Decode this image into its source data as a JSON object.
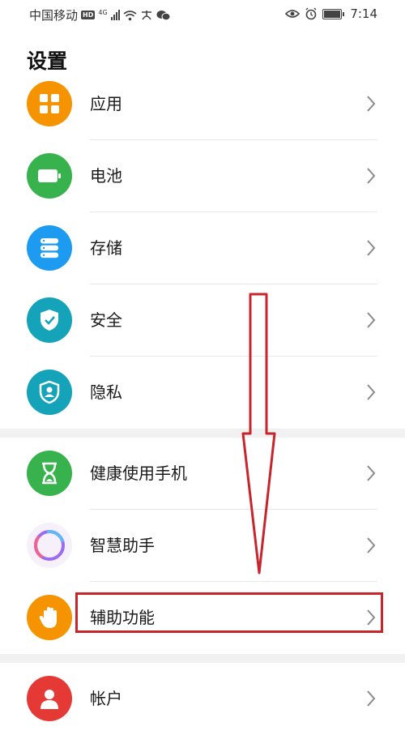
{
  "status_bar": {
    "carrier": "中国移动",
    "hd_badge": "HD",
    "network": "4G",
    "time": "7:14"
  },
  "page": {
    "title": "设置"
  },
  "settings": {
    "items": [
      {
        "label": "应用",
        "icon": "apps-icon",
        "color": "#f59300"
      },
      {
        "label": "电池",
        "icon": "battery-icon",
        "color": "#37b24d"
      },
      {
        "label": "存储",
        "icon": "storage-icon",
        "color": "#1d9bf0"
      },
      {
        "label": "安全",
        "icon": "shield-check-icon",
        "color": "#14a3b8"
      },
      {
        "label": "隐私",
        "icon": "privacy-icon",
        "color": "#14a3b8"
      },
      {
        "label": "健康使用手机",
        "icon": "hourglass-icon",
        "color": "#37b24d"
      },
      {
        "label": "智慧助手",
        "icon": "smart-assistant-icon",
        "color": "#b06fe0"
      },
      {
        "label": "辅助功能",
        "icon": "hand-icon",
        "color": "#f59300"
      },
      {
        "label": "帐户",
        "icon": "account-icon",
        "color": "#e53935"
      }
    ]
  },
  "annotation": {
    "color": "#c8242c"
  }
}
